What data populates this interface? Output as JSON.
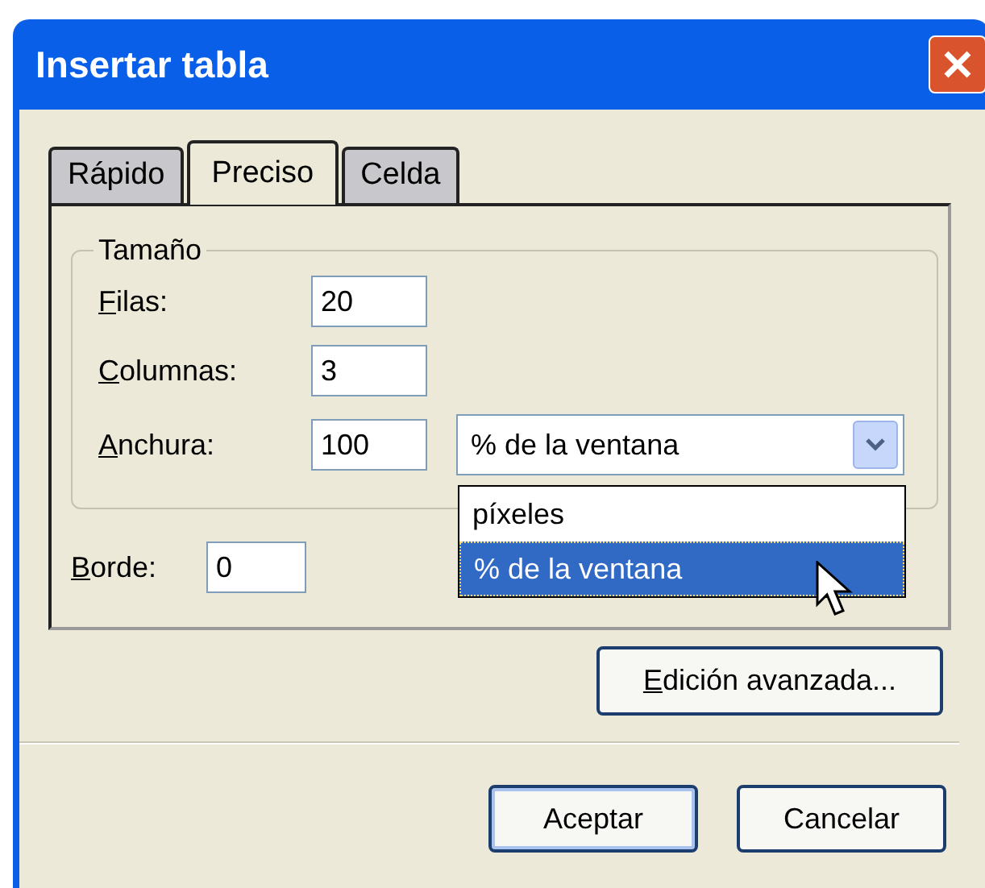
{
  "window": {
    "title": "Insertar tabla"
  },
  "tabs": [
    {
      "label": "Rápido",
      "selected": false
    },
    {
      "label": "Preciso",
      "selected": true
    },
    {
      "label": "Celda",
      "selected": false
    }
  ],
  "size_group": {
    "title": "Tamaño",
    "fields": [
      {
        "label": "Filas:",
        "first_letter_underlined": true,
        "value": "20"
      },
      {
        "label": "Columnas:",
        "first_letter_underlined": true,
        "value": "3"
      },
      {
        "label": "Anchura:",
        "first_letter_underlined": true,
        "value": "100"
      }
    ],
    "width_unit": {
      "value": "% de la ventana",
      "expanded": true,
      "options": [
        {
          "label": "píxeles",
          "selected": false
        },
        {
          "label": "% de la ventana",
          "selected": true
        }
      ]
    }
  },
  "border_field": {
    "label": "Borde:",
    "first_letter_underlined": true,
    "value": "0"
  },
  "advanced_button": {
    "label": "Edición avanzada...",
    "first_letter_underlined": true
  },
  "buttons": [
    {
      "label": "Aceptar",
      "default": true
    },
    {
      "label": "Cancelar",
      "default": false
    }
  ]
}
